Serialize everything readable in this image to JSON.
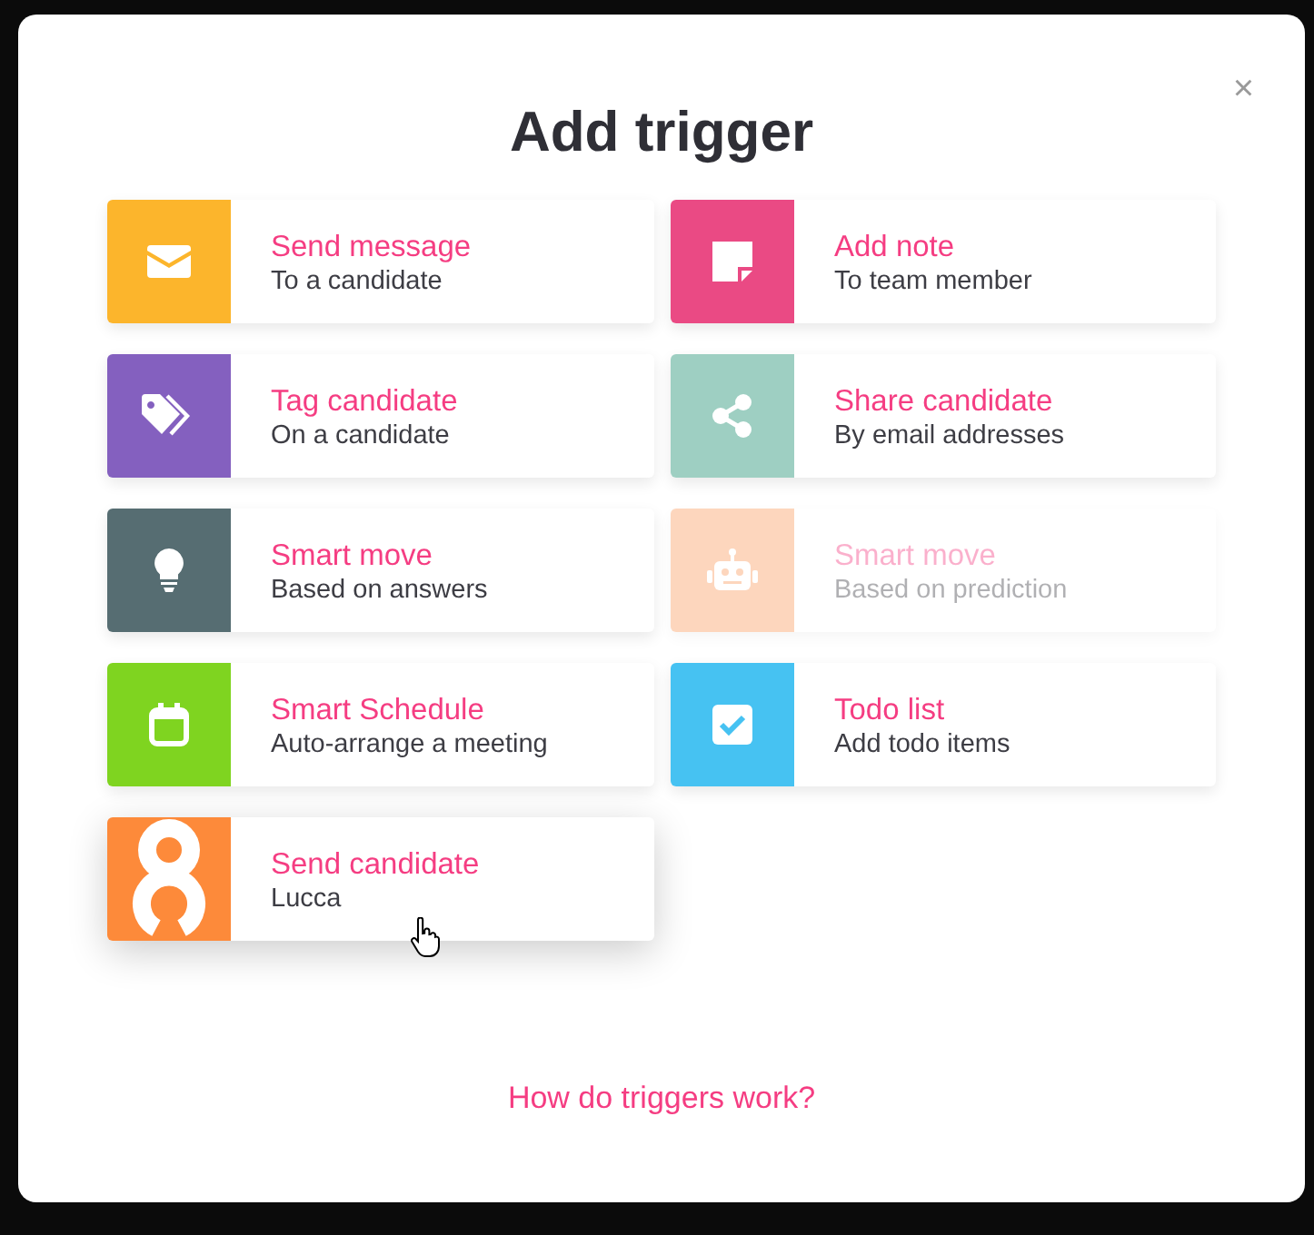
{
  "dialog": {
    "title": "Add trigger",
    "close": "×"
  },
  "triggers": [
    {
      "kind": "envelope",
      "color": "#fcb52c",
      "title": "Send message",
      "subtitle": "To a candidate",
      "disabled": false,
      "hovered": false
    },
    {
      "kind": "note",
      "color": "#ea4a84",
      "title": "Add note",
      "subtitle": "To team member",
      "disabled": false,
      "hovered": false
    },
    {
      "kind": "tags",
      "color": "#8460bf",
      "title": "Tag candidate",
      "subtitle": "On a candidate",
      "disabled": false,
      "hovered": false
    },
    {
      "kind": "share",
      "color": "#9ecfc2",
      "title": "Share candidate",
      "subtitle": "By email addresses",
      "disabled": false,
      "hovered": false
    },
    {
      "kind": "bulb",
      "color": "#566d72",
      "title": "Smart move",
      "subtitle": "Based on answers",
      "disabled": false,
      "hovered": false
    },
    {
      "kind": "robot",
      "color": "#fdd6bd",
      "title": "Smart move",
      "subtitle": "Based on prediction",
      "disabled": true,
      "hovered": false
    },
    {
      "kind": "calendar",
      "color": "#7fd420",
      "title": "Smart Schedule",
      "subtitle": "Auto-arrange a meeting",
      "disabled": false,
      "hovered": false
    },
    {
      "kind": "checkbox",
      "color": "#46c2f2",
      "title": "Todo list",
      "subtitle": "Add todo items",
      "disabled": false,
      "hovered": false
    },
    {
      "kind": "logo",
      "color": "#fd8a3a",
      "title": "Send candidate",
      "subtitle": "Lucca",
      "disabled": false,
      "hovered": true
    }
  ],
  "help_link": "How do triggers work?"
}
